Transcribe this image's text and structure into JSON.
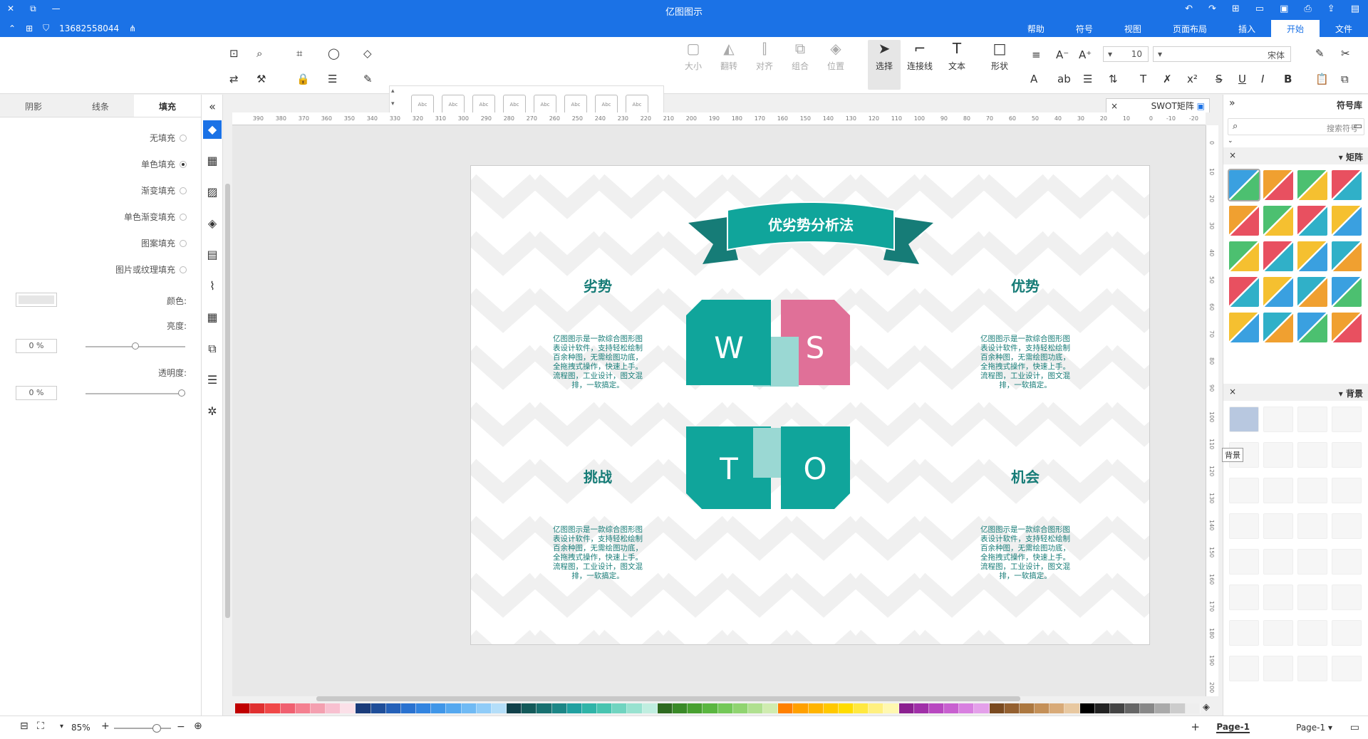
{
  "app": {
    "title": "亿图图示",
    "account": "13682558044"
  },
  "titlebar": {
    "min": "▭",
    "restore": "⧉",
    "close": "✕"
  },
  "menu": {
    "tabs": [
      "文件",
      "开始",
      "插入",
      "页面布局",
      "视图",
      "符号",
      "帮助"
    ],
    "active": "开始"
  },
  "ribbon": {
    "font": "宋体",
    "font_size": "10",
    "select_label": "选择",
    "shape_label": "形状",
    "text_label": "文本",
    "connector_label": "连接线",
    "position_label": "位置",
    "group_label": "组合",
    "align_label": "对齐",
    "flip_label": "翻转",
    "size_label": "大小",
    "style_chip": "Abc"
  },
  "format_panel": {
    "tabs": [
      "填充",
      "线条",
      "阴影"
    ],
    "active": "填充",
    "fill_options": [
      "无填充",
      "单色填充",
      "渐变填充",
      "单色渐变填充",
      "图案填充",
      "图片或纹理填充"
    ],
    "selected_option": "单色填充",
    "color_label": "颜色:",
    "shade_label": "亮度:",
    "shade_value": "0 %",
    "transparency_label": "透明度:",
    "transparency_value": "0 %"
  },
  "document": {
    "tab_label": "SWOT矩阵",
    "close": "×"
  },
  "diagram": {
    "title": "优劣势分析法",
    "quadrants": [
      {
        "heading": "优势",
        "letter": "S",
        "color": "#e07098"
      },
      {
        "heading": "劣势",
        "letter": "W",
        "color": "#10a59b"
      },
      {
        "heading": "机会",
        "letter": "O",
        "color": "#10a59b"
      },
      {
        "heading": "挑战",
        "letter": "T",
        "color": "#10a59b"
      }
    ],
    "body_text": [
      "亿图图示是一款综合图形图",
      "表设计软件，支持轻松绘制",
      "百余种图，无需绘图功底，",
      "全拖拽式操作，快速上手。",
      "流程图，工业设计，图文混",
      "排，一软搞定。"
    ],
    "colors": {
      "teal": "#10a59b",
      "teal_light": "#5cc3bd",
      "teal_pale": "#9ad8d3",
      "ribbon": "#167c77",
      "pink": "#e07098"
    }
  },
  "library": {
    "title": "符号库",
    "search_placeholder": "搜索符号",
    "category_matrix": "矩阵",
    "category_background": "背景",
    "tooltip": "背景"
  },
  "status": {
    "page_select": "Page-1",
    "page_tab": "Page-1",
    "add_page": "+",
    "zoom": "85%"
  },
  "ruler": {
    "h_ticks": [
      "-20",
      "-10",
      "0",
      "10",
      "20",
      "30",
      "40",
      "50",
      "60",
      "70",
      "80",
      "90",
      "100",
      "110",
      "120",
      "130",
      "140",
      "150",
      "160",
      "170",
      "180",
      "190",
      "200",
      "210",
      "220",
      "230",
      "240",
      "250",
      "260",
      "270",
      "280",
      "290",
      "300",
      "310",
      "320",
      "330",
      "340",
      "350",
      "360",
      "370",
      "380",
      "390"
    ],
    "v_ticks": [
      "0",
      "10",
      "20",
      "30",
      "40",
      "50",
      "60",
      "70",
      "80",
      "90",
      "100",
      "110",
      "120",
      "130",
      "140",
      "150",
      "160",
      "170",
      "180",
      "190",
      "200"
    ]
  },
  "palette": [
    "#c00000",
    "#e03030",
    "#f04848",
    "#f06070",
    "#f48090",
    "#f4a0b0",
    "#f8c0d0",
    "#fbe0e8",
    "#1a3c7a",
    "#1f4e99",
    "#2460b8",
    "#2a72d0",
    "#3284e0",
    "#4096e8",
    "#55a8ef",
    "#70baf4",
    "#90ccf8",
    "#b4def9",
    "#10404a",
    "#145a5a",
    "#187070",
    "#1c8686",
    "#20a0a0",
    "#30b4a8",
    "#48c4b0",
    "#70d4c0",
    "#98e2d0",
    "#c0eee0",
    "#2e6a20",
    "#3a8a28",
    "#48a030",
    "#5ab640",
    "#74c858",
    "#90d470",
    "#b0e090",
    "#d0ecb0",
    "#ff8000",
    "#ffa000",
    "#ffb400",
    "#ffc800",
    "#ffdc00",
    "#ffe840",
    "#fff080",
    "#fff8b0",
    "#8b2090",
    "#a030a8",
    "#b848c0",
    "#c860d0",
    "#d880e0",
    "#e4a0ea",
    "#7a4a20",
    "#946030",
    "#ac7840",
    "#c49058",
    "#d8aa78",
    "#e8c8a0",
    "#000000",
    "#222222",
    "#444444",
    "#666666",
    "#888888",
    "#aaaaaa",
    "#cccccc",
    "#eeeeee"
  ]
}
